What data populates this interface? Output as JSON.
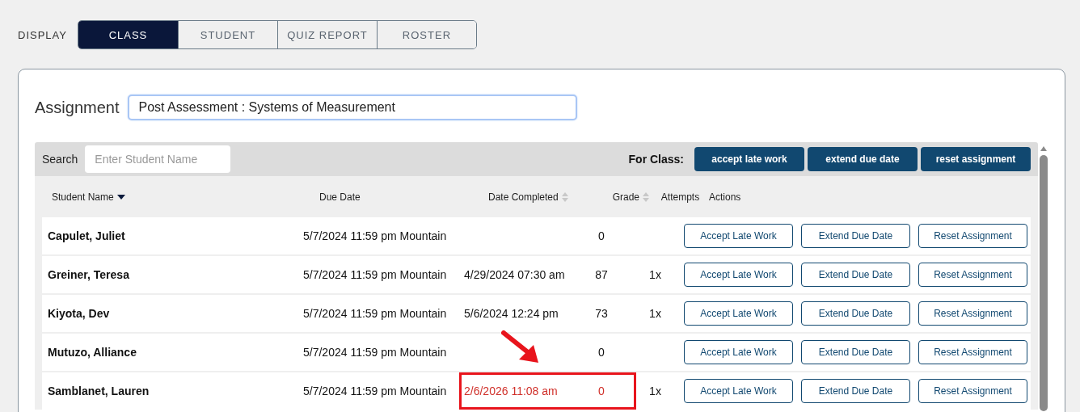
{
  "display_label": "DISPLAY",
  "tabs": [
    {
      "label": "CLASS",
      "selected": true
    },
    {
      "label": "STUDENT",
      "selected": false
    },
    {
      "label": "QUIZ REPORT",
      "selected": false
    },
    {
      "label": "ROSTER",
      "selected": false
    }
  ],
  "assignment": {
    "label": "Assignment",
    "value": "Post Assessment : Systems of Measurement"
  },
  "toolbar": {
    "search_label": "Search",
    "search_placeholder": "Enter Student Name",
    "for_class_label": "For Class:",
    "buttons": [
      "accept late work",
      "extend due date",
      "reset assignment"
    ]
  },
  "columns": [
    {
      "label": "Student Name",
      "sorted": true
    },
    {
      "label": "Due Date",
      "sorted": false
    },
    {
      "label": "Date Completed",
      "sortable": true,
      "sorted": false
    },
    {
      "label": "Grade",
      "sortable": true,
      "sorted": false
    },
    {
      "label": "Attempts",
      "sorted": false
    },
    {
      "label": "Actions",
      "sorted": false
    }
  ],
  "rows": [
    {
      "name": "Capulet, Juliet",
      "due": "5/7/2024 11:59 pm Mountain",
      "completed": "",
      "grade": "0",
      "attempts": "",
      "flagged": false,
      "actions": [
        "Accept Late Work",
        "Extend Due Date",
        "Reset Assignment"
      ]
    },
    {
      "name": "Greiner, Teresa",
      "due": "5/7/2024 11:59 pm Mountain",
      "completed": "4/29/2024 07:30 am",
      "grade": "87",
      "attempts": "1x",
      "flagged": false,
      "actions": [
        "Accept Late Work",
        "Extend Due Date",
        "Reset Assignment"
      ]
    },
    {
      "name": "Kiyota, Dev",
      "due": "5/7/2024 11:59 pm Mountain",
      "completed": "5/6/2024 12:24 pm",
      "grade": "73",
      "attempts": "1x",
      "flagged": false,
      "actions": [
        "Accept Late Work",
        "Extend Due Date",
        "Reset Assignment"
      ]
    },
    {
      "name": "Mutuzo, Alliance",
      "due": "5/7/2024 11:59 pm Mountain",
      "completed": "",
      "grade": "0",
      "attempts": "",
      "flagged": false,
      "actions": [
        "Accept Late Work",
        "Extend Due Date",
        "Reset Assignment"
      ]
    },
    {
      "name": "Samblanet, Lauren",
      "due": "5/7/2024 11:59 pm Mountain",
      "completed": "2/6/2026 11:08 am",
      "grade": "0",
      "attempts": "1x",
      "flagged": true,
      "actions": [
        "Accept Late Work",
        "Extend Due Date",
        "Reset Assignment"
      ]
    }
  ]
}
